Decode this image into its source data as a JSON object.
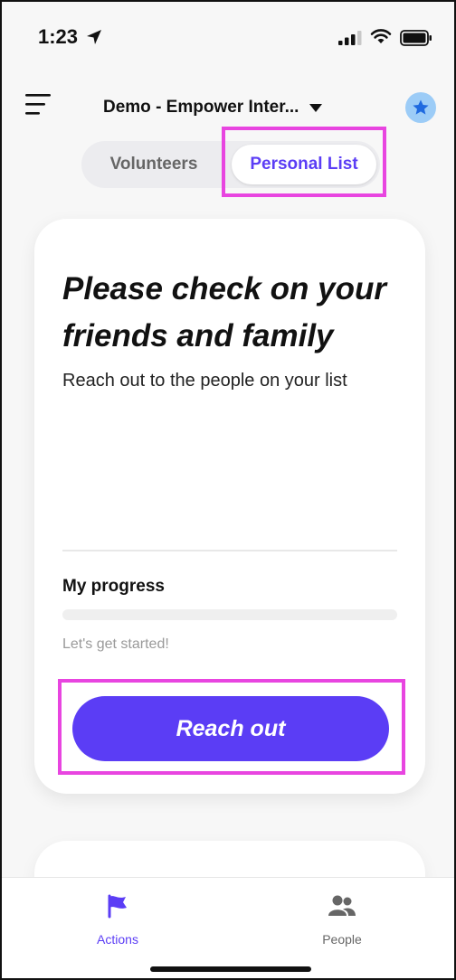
{
  "status_bar": {
    "time": "1:23"
  },
  "header": {
    "workspace_title": "Demo - Empower Inter..."
  },
  "tabs": [
    {
      "label": "Volunteers",
      "selected": false
    },
    {
      "label": "Personal List",
      "selected": true
    }
  ],
  "card": {
    "title": "Please check on your friends and family",
    "subtitle": "Reach out to the people on your list",
    "progress_label": "My progress",
    "progress_value": 0,
    "progress_status": "Let's get started!",
    "button_label": "Reach out"
  },
  "bottom_nav": [
    {
      "label": "Actions",
      "icon": "flag-icon",
      "active": true
    },
    {
      "label": "People",
      "icon": "people-icon",
      "active": false
    }
  ],
  "colors": {
    "accent": "#5b3df5",
    "highlight": "#e845e0",
    "star_bg": "#9cccf7",
    "star": "#1f6ae0"
  }
}
